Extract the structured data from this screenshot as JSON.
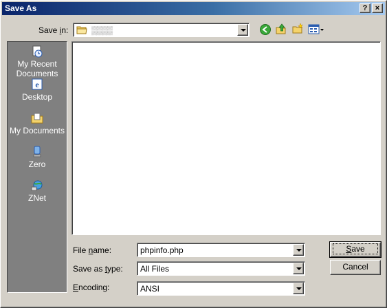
{
  "window": {
    "title": "Save As",
    "help_label": "?",
    "close_label": "×"
  },
  "toolbar": {
    "save_in_label": "Save ",
    "save_in_underline": "i",
    "save_in_rest": "n:",
    "save_in_value": "▒▒▒▒",
    "icons": [
      "back-icon",
      "up-folder-icon",
      "new-folder-icon",
      "view-menu-icon"
    ]
  },
  "places": [
    {
      "label": "My Recent Documents",
      "icon": "recent-documents-icon"
    },
    {
      "label": "Desktop",
      "icon": "desktop-icon"
    },
    {
      "label": "My Documents",
      "icon": "my-documents-icon"
    },
    {
      "label": "Zero",
      "icon": "user-computer-icon"
    },
    {
      "label": "ZNet",
      "icon": "network-icon"
    }
  ],
  "form": {
    "file_name": {
      "label_pre": "File ",
      "label_u": "n",
      "label_post": "ame:",
      "value": "phpinfo.php"
    },
    "save_as_type": {
      "label_pre": "Save as ",
      "label_u": "t",
      "label_post": "ype:",
      "value": "All Files"
    },
    "encoding": {
      "label_pre": "",
      "label_u": "E",
      "label_post": "ncoding:",
      "value": "ANSI"
    }
  },
  "buttons": {
    "save_u": "S",
    "save_rest": "ave",
    "cancel": "Cancel"
  }
}
